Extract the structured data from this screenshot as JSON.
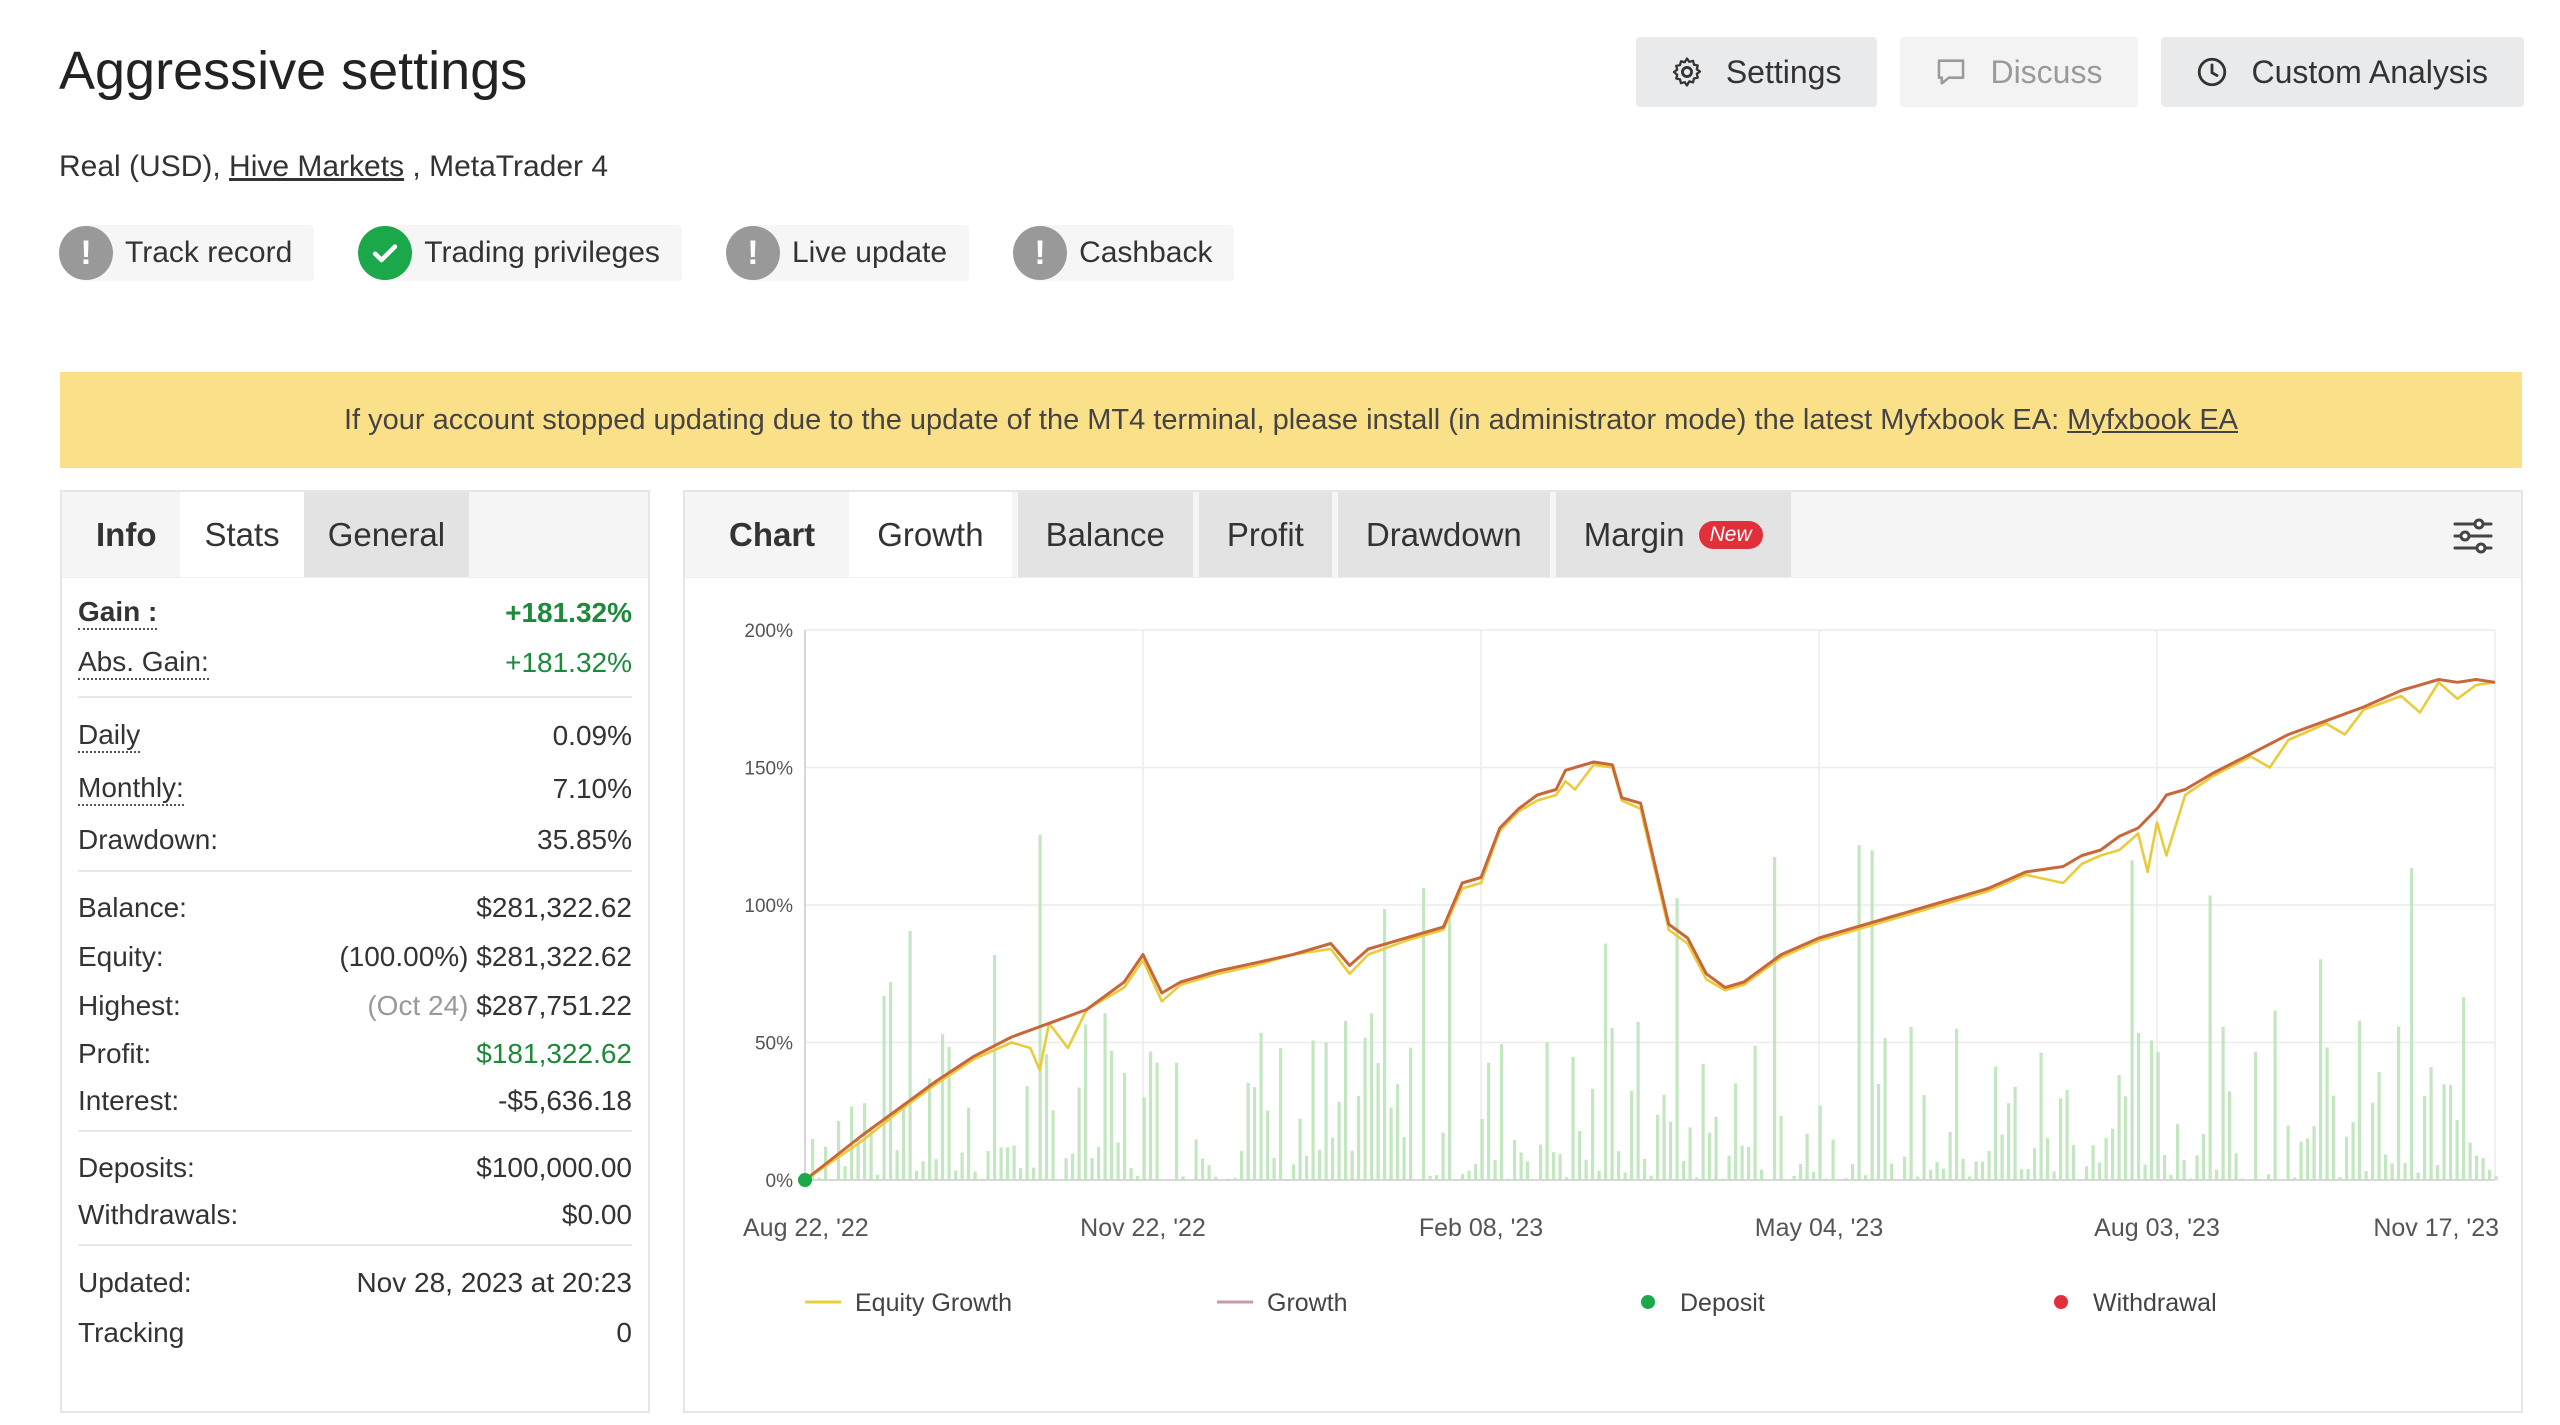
{
  "title": "Aggressive settings",
  "account": {
    "prefix": "Real (USD), ",
    "broker": "Hive Markets",
    "suffix": " , MetaTrader 4"
  },
  "buttons": {
    "settings": "Settings",
    "discuss": "Discuss",
    "custom_analysis": "Custom Analysis"
  },
  "badges": [
    {
      "label": "Track record",
      "status": "warn"
    },
    {
      "label": "Trading privileges",
      "status": "ok"
    },
    {
      "label": "Live update",
      "status": "warn"
    },
    {
      "label": "Cashback",
      "status": "warn"
    }
  ],
  "notice": {
    "text": "If your account stopped updating due to the update of the MT4 terminal, please install (in administrator mode) the latest Myfxbook EA:",
    "link": "Myfxbook EA"
  },
  "left_tabs": [
    "Info",
    "Stats",
    "General"
  ],
  "stats": {
    "gain": {
      "label": "Gain :",
      "value": "+181.32%"
    },
    "abs_gain": {
      "label": "Abs. Gain:",
      "value": "+181.32%"
    },
    "daily": {
      "label": "Daily",
      "value": "0.09%"
    },
    "monthly": {
      "label": "Monthly:",
      "value": "7.10%"
    },
    "drawdown": {
      "label": "Drawdown:",
      "value": "35.85%"
    },
    "balance": {
      "label": "Balance:",
      "value": "$281,322.62"
    },
    "equity": {
      "label": "Equity:",
      "pct": "(100.00%)",
      "value": "$281,322.62"
    },
    "highest": {
      "label": "Highest:",
      "date": "(Oct 24)",
      "value": "$287,751.22"
    },
    "profit": {
      "label": "Profit:",
      "value": "$181,322.62"
    },
    "interest": {
      "label": "Interest:",
      "value": "-$5,636.18"
    },
    "deposits": {
      "label": "Deposits:",
      "value": "$100,000.00"
    },
    "withdrawals": {
      "label": "Withdrawals:",
      "value": "$0.00"
    },
    "updated": {
      "label": "Updated:",
      "value": "Nov 28, 2023 at 20:23"
    },
    "tracking": {
      "label": "Tracking",
      "value": "0"
    }
  },
  "right_tabs": [
    "Chart",
    "Growth",
    "Balance",
    "Profit",
    "Drawdown",
    "Margin"
  ],
  "new_badge": "New",
  "colors": {
    "growth": "#c8683a",
    "equity": "#e9cc3c",
    "bars": "#b9e3b5",
    "deposit": "#1aa84b",
    "withdrawal": "#e2303a",
    "notice_bg": "#fbe08a"
  },
  "chart_data": {
    "type": "line",
    "y_ticks": [
      "200%",
      "150%",
      "100%",
      "50%",
      "0%"
    ],
    "x_ticks": [
      "Aug 22, '22",
      "Nov 22, '22",
      "Feb 08, '23",
      "May 04, '23",
      "Aug 03, '23",
      "Nov 17, '23"
    ],
    "ylim": [
      0,
      200
    ],
    "legend": [
      "Equity Growth",
      "Growth",
      "Deposit",
      "Withdrawal"
    ],
    "series": [
      {
        "name": "Growth",
        "points": [
          [
            0,
            0
          ],
          [
            3,
            8
          ],
          [
            6,
            16
          ],
          [
            10,
            26
          ],
          [
            14,
            36
          ],
          [
            18,
            45
          ],
          [
            22,
            52
          ],
          [
            26,
            57
          ],
          [
            30,
            62
          ],
          [
            34,
            72
          ],
          [
            36,
            82
          ],
          [
            38,
            68
          ],
          [
            40,
            72
          ],
          [
            44,
            76
          ],
          [
            48,
            79
          ],
          [
            52,
            82
          ],
          [
            56,
            86
          ],
          [
            58,
            78
          ],
          [
            60,
            84
          ],
          [
            64,
            88
          ],
          [
            68,
            92
          ],
          [
            70,
            108
          ],
          [
            72,
            110
          ],
          [
            74,
            128
          ],
          [
            76,
            135
          ],
          [
            78,
            140
          ],
          [
            80,
            142
          ],
          [
            81,
            149
          ],
          [
            82,
            150
          ],
          [
            84,
            152
          ],
          [
            86,
            151
          ],
          [
            87,
            139
          ],
          [
            89,
            137
          ],
          [
            92,
            93
          ],
          [
            94,
            88
          ],
          [
            96,
            75
          ],
          [
            98,
            70
          ],
          [
            100,
            72
          ],
          [
            104,
            82
          ],
          [
            108,
            88
          ],
          [
            112,
            92
          ],
          [
            116,
            96
          ],
          [
            120,
            100
          ],
          [
            126,
            106
          ],
          [
            130,
            112
          ],
          [
            134,
            114
          ],
          [
            136,
            118
          ],
          [
            138,
            120
          ],
          [
            140,
            125
          ],
          [
            142,
            128
          ],
          [
            144,
            135
          ],
          [
            145,
            140
          ],
          [
            147,
            142
          ],
          [
            150,
            148
          ],
          [
            154,
            155
          ],
          [
            158,
            162
          ],
          [
            162,
            167
          ],
          [
            166,
            172
          ],
          [
            170,
            178
          ],
          [
            174,
            182
          ],
          [
            176,
            181
          ],
          [
            178,
            182
          ],
          [
            180,
            181
          ]
        ]
      },
      {
        "name": "Equity Growth",
        "points": [
          [
            0,
            0
          ],
          [
            3,
            7
          ],
          [
            6,
            14
          ],
          [
            10,
            25
          ],
          [
            14,
            35
          ],
          [
            18,
            44
          ],
          [
            22,
            50
          ],
          [
            24,
            48
          ],
          [
            25,
            40
          ],
          [
            26,
            57
          ],
          [
            28,
            48
          ],
          [
            30,
            62
          ],
          [
            34,
            70
          ],
          [
            36,
            80
          ],
          [
            38,
            65
          ],
          [
            40,
            71
          ],
          [
            44,
            75
          ],
          [
            48,
            78
          ],
          [
            52,
            82
          ],
          [
            56,
            84
          ],
          [
            58,
            75
          ],
          [
            60,
            82
          ],
          [
            64,
            87
          ],
          [
            68,
            91
          ],
          [
            70,
            106
          ],
          [
            72,
            108
          ],
          [
            74,
            127
          ],
          [
            76,
            134
          ],
          [
            78,
            138
          ],
          [
            80,
            140
          ],
          [
            81,
            145
          ],
          [
            82,
            142
          ],
          [
            84,
            151
          ],
          [
            86,
            150
          ],
          [
            87,
            138
          ],
          [
            89,
            135
          ],
          [
            92,
            91
          ],
          [
            94,
            86
          ],
          [
            96,
            73
          ],
          [
            98,
            69
          ],
          [
            100,
            71
          ],
          [
            104,
            81
          ],
          [
            108,
            87
          ],
          [
            112,
            91
          ],
          [
            116,
            95
          ],
          [
            120,
            99
          ],
          [
            126,
            105
          ],
          [
            130,
            111
          ],
          [
            134,
            108
          ],
          [
            136,
            115
          ],
          [
            138,
            118
          ],
          [
            140,
            120
          ],
          [
            142,
            126
          ],
          [
            143,
            112
          ],
          [
            144,
            130
          ],
          [
            145,
            118
          ],
          [
            147,
            140
          ],
          [
            150,
            147
          ],
          [
            154,
            154
          ],
          [
            156,
            150
          ],
          [
            158,
            160
          ],
          [
            162,
            166
          ],
          [
            164,
            162
          ],
          [
            166,
            171
          ],
          [
            170,
            176
          ],
          [
            172,
            170
          ],
          [
            174,
            181
          ],
          [
            176,
            175
          ],
          [
            178,
            180
          ],
          [
            180,
            181
          ]
        ]
      }
    ],
    "x_range": [
      0,
      180
    ],
    "deposit_points": [
      [
        0,
        0
      ]
    ]
  }
}
